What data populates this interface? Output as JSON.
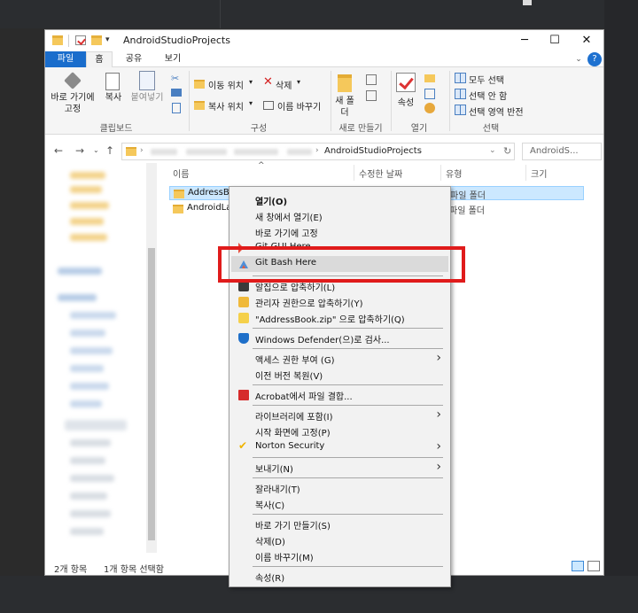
{
  "window": {
    "title": "AndroidStudioProjects",
    "minimize": "─",
    "maximize": "☐",
    "close": "✕"
  },
  "ribbon_tabs": [
    "파일",
    "홈",
    "공유",
    "보기"
  ],
  "ribbon_tabs_extra": {
    "collapse": "⌄",
    "help": "?"
  },
  "ribbon": {
    "clipboard": {
      "pin_label": "바로 가기에 고정",
      "copy_label": "복사",
      "paste_label": "붙여넣기",
      "group_label": "클립보드"
    },
    "organize": {
      "move_to": "이동 위치",
      "copy_to": "복사 위치",
      "delete": "삭제",
      "rename": "이름 바꾸기",
      "group_label": "구성"
    },
    "new": {
      "new_folder": "새 폴더",
      "group_label": "새로 만들기"
    },
    "open": {
      "properties": "속성",
      "group_label": "열기"
    },
    "select": {
      "select_all": "모두 선택",
      "select_none": "선택 안 함",
      "invert": "선택 영역 반전",
      "group_label": "선택"
    }
  },
  "address": {
    "current": "AndroidStudioProjects",
    "search_placeholder": "AndroidS..."
  },
  "columns": [
    "이름",
    "수정한 날짜",
    "유형",
    "크기"
  ],
  "files": [
    {
      "name": "AddressBook",
      "type": "파일 폴더",
      "selected": true
    },
    {
      "name": "AndroidLab",
      "type": "파일 폴더",
      "selected": false
    }
  ],
  "status": {
    "count": "2개 항목",
    "selected": "1개 항목 선택함"
  },
  "context_menu": {
    "items": [
      {
        "label": "열기(O)",
        "bold": true
      },
      {
        "label": "새 창에서 열기(E)"
      },
      {
        "label": "바로 가기에 고정"
      },
      {
        "label": "Git GUI Here",
        "icon": "git-gui-icon"
      },
      {
        "label": "Git Bash Here",
        "icon": "git-bash-icon",
        "hover": true
      },
      {
        "label": "알집으로 압축하기(L)",
        "icon": "alzip-icon"
      },
      {
        "label": "관리자 권한으로 압축하기(Y)",
        "icon": "alzip-admin-icon"
      },
      {
        "label": "\"AddressBook.zip\" 으로 압축하기(Q)",
        "icon": "alzip-zip-icon"
      },
      {
        "label": "Windows Defender(으)로 검사...",
        "icon": "defender-icon"
      },
      {
        "label": "액세스 권한 부여 (G)",
        "submenu": true
      },
      {
        "label": "이전 버전 복원(V)"
      },
      {
        "label": "Acrobat에서 파일 결합...",
        "icon": "acrobat-icon"
      },
      {
        "label": "라이브러리에 포함(I)",
        "submenu": true
      },
      {
        "label": "시작 화면에 고정(P)"
      },
      {
        "label": "Norton Security",
        "icon": "norton-icon",
        "submenu": true
      },
      {
        "label": "보내기(N)",
        "submenu": true
      },
      {
        "label": "잘라내기(T)"
      },
      {
        "label": "복사(C)"
      },
      {
        "label": "바로 가기 만들기(S)"
      },
      {
        "label": "삭제(D)"
      },
      {
        "label": "이름 바꾸기(M)"
      },
      {
        "label": "속성(R)"
      }
    ],
    "submenu_arrow": "›"
  },
  "colors": {
    "accent": "#1a6dcc",
    "highlight_box": "#e01b1b",
    "selection": "#cce8ff"
  }
}
